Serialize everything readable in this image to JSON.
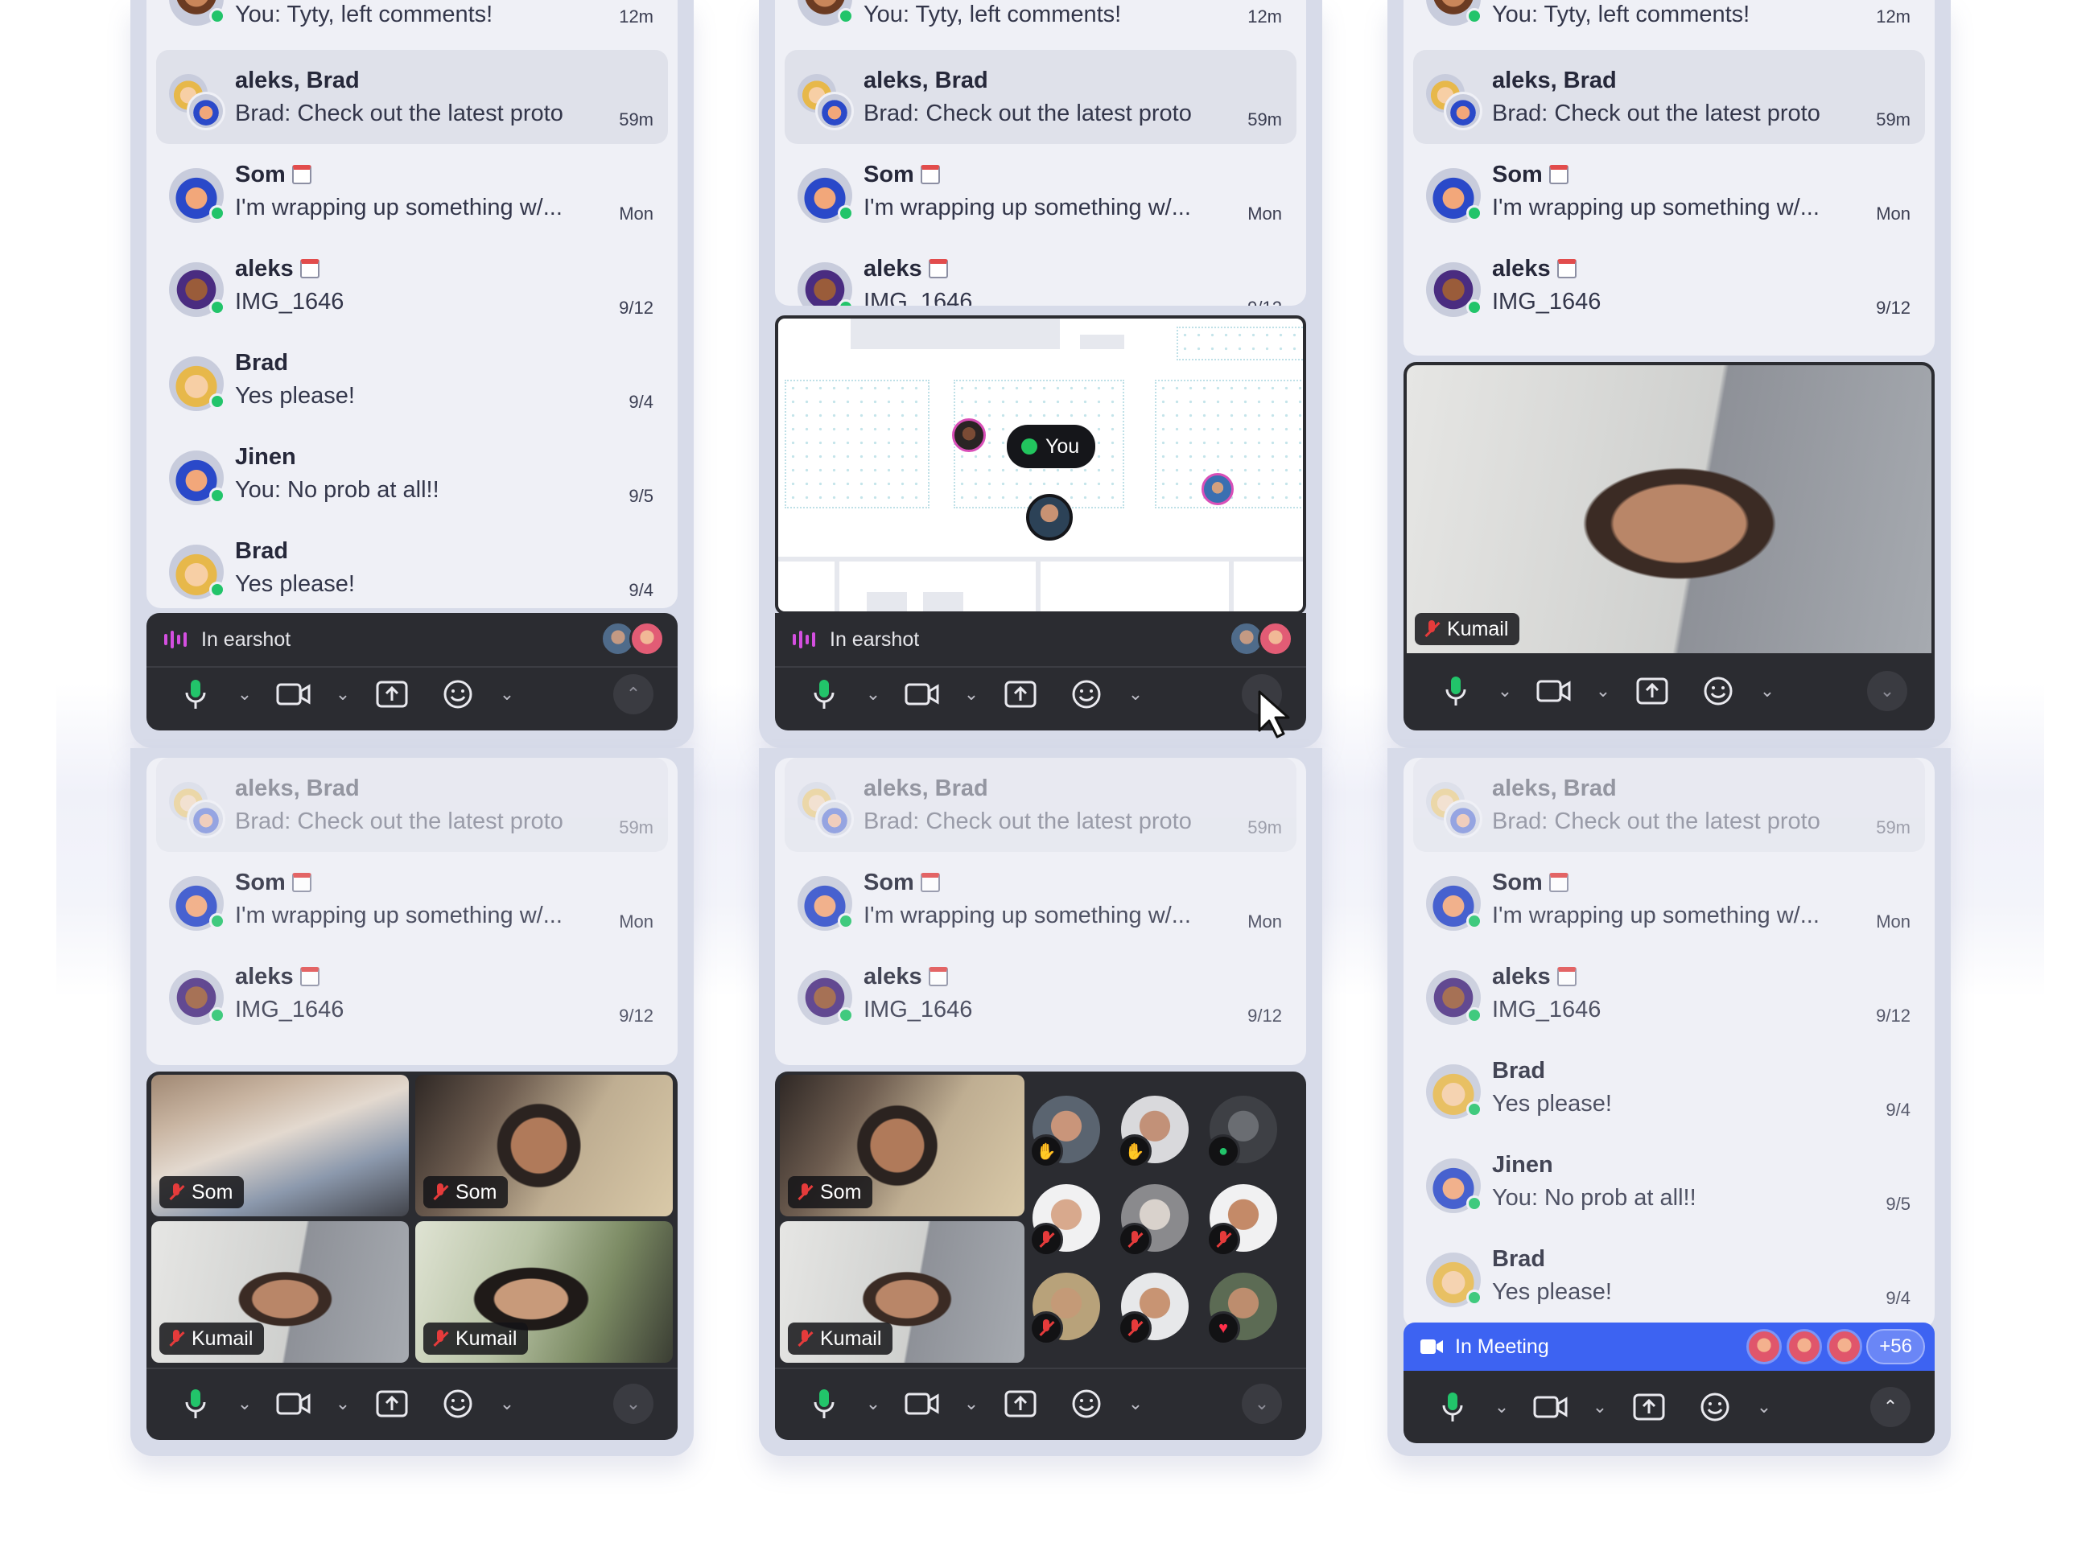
{
  "chats": {
    "tyty": {
      "name": "",
      "msg": "You: Tyty, left comments!",
      "time": "12m"
    },
    "group": {
      "name": "aleks, Brad",
      "msg": "Brad: Check out the latest proto",
      "time": "59m"
    },
    "som": {
      "name": "Som",
      "msg": "I'm wrapping up something w/...",
      "time": "Mon"
    },
    "aleks": {
      "name": "aleks",
      "msg": "IMG_1646",
      "time": "9/12"
    },
    "brad": {
      "name": "Brad",
      "msg": "Yes please!",
      "time": "9/4"
    },
    "jinen": {
      "name": "Jinen",
      "msg": "You: No prob at all!!",
      "time": "9/5"
    }
  },
  "earshot_label": "In earshot",
  "meeting_label": "In Meeting",
  "meeting_more": "+56",
  "you_label": "You",
  "video_names": {
    "som": "Som",
    "kumail": "Kumail"
  },
  "colors": {
    "online": "#22c46a",
    "meeting_blue": "#3d63f2",
    "bar": "#2b2c31",
    "muted_red": "#e53b3b"
  },
  "icons": [
    "mic-icon",
    "chevron-down-icon",
    "camera-icon",
    "share-screen-icon",
    "emoji-icon",
    "chevron-up-icon",
    "calendar-icon",
    "waveform-icon",
    "mic-muted-icon",
    "hand-raise-icon",
    "heart-icon",
    "cursor-icon"
  ]
}
